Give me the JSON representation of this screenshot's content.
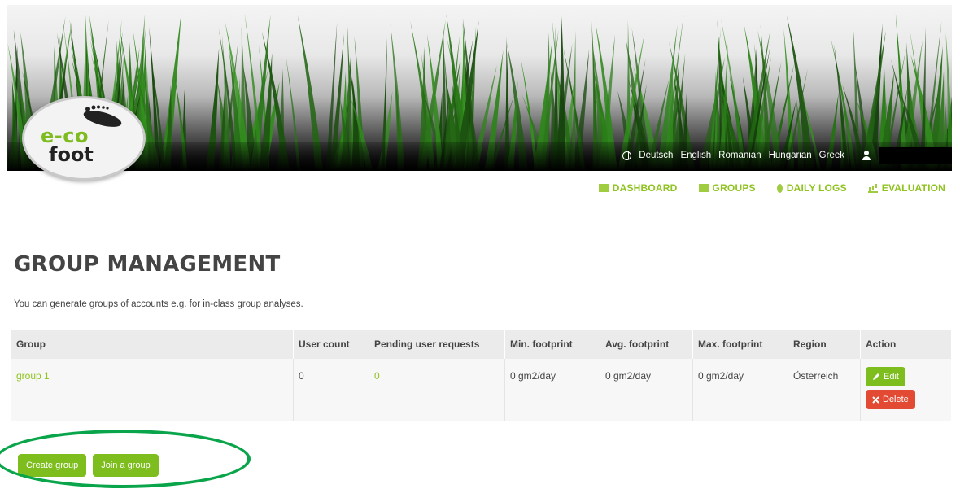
{
  "logo": {
    "line1": "e-co",
    "line2": "foot"
  },
  "languages": {
    "items": [
      {
        "label": "Deutsch"
      },
      {
        "label": "English"
      },
      {
        "label": "Romanian"
      },
      {
        "label": "Hungarian"
      },
      {
        "label": "Greek"
      }
    ]
  },
  "nav": {
    "items": [
      {
        "label": "DASHBOARD",
        "icon": "dashboard-icon"
      },
      {
        "label": "GROUPS",
        "icon": "groups-icon"
      },
      {
        "label": "DAILY LOGS",
        "icon": "pin-icon"
      },
      {
        "label": "EVALUATION",
        "icon": "bar-chart-icon"
      }
    ]
  },
  "page": {
    "title": "GROUP MANAGEMENT",
    "description": "You can generate groups of accounts e.g. for in-class group analyses."
  },
  "table": {
    "headers": [
      "Group",
      "User count",
      "Pending user requests",
      "Min. footprint",
      "Avg. footprint",
      "Max. footprint",
      "Region",
      "Action"
    ],
    "rows": [
      {
        "group": "group 1",
        "user_count": "0",
        "pending": "0",
        "min": "0 gm2/day",
        "avg": "0 gm2/day",
        "max": "0 gm2/day",
        "region": "Österreich",
        "edit_label": "Edit",
        "delete_label": "Delete"
      }
    ]
  },
  "actions": {
    "create_label": "Create group",
    "join_label": "Join a group"
  },
  "colors": {
    "accent_green": "#7dbe1e",
    "delete_red": "#e34a34",
    "highlight_ellipse": "#0aa54b"
  }
}
